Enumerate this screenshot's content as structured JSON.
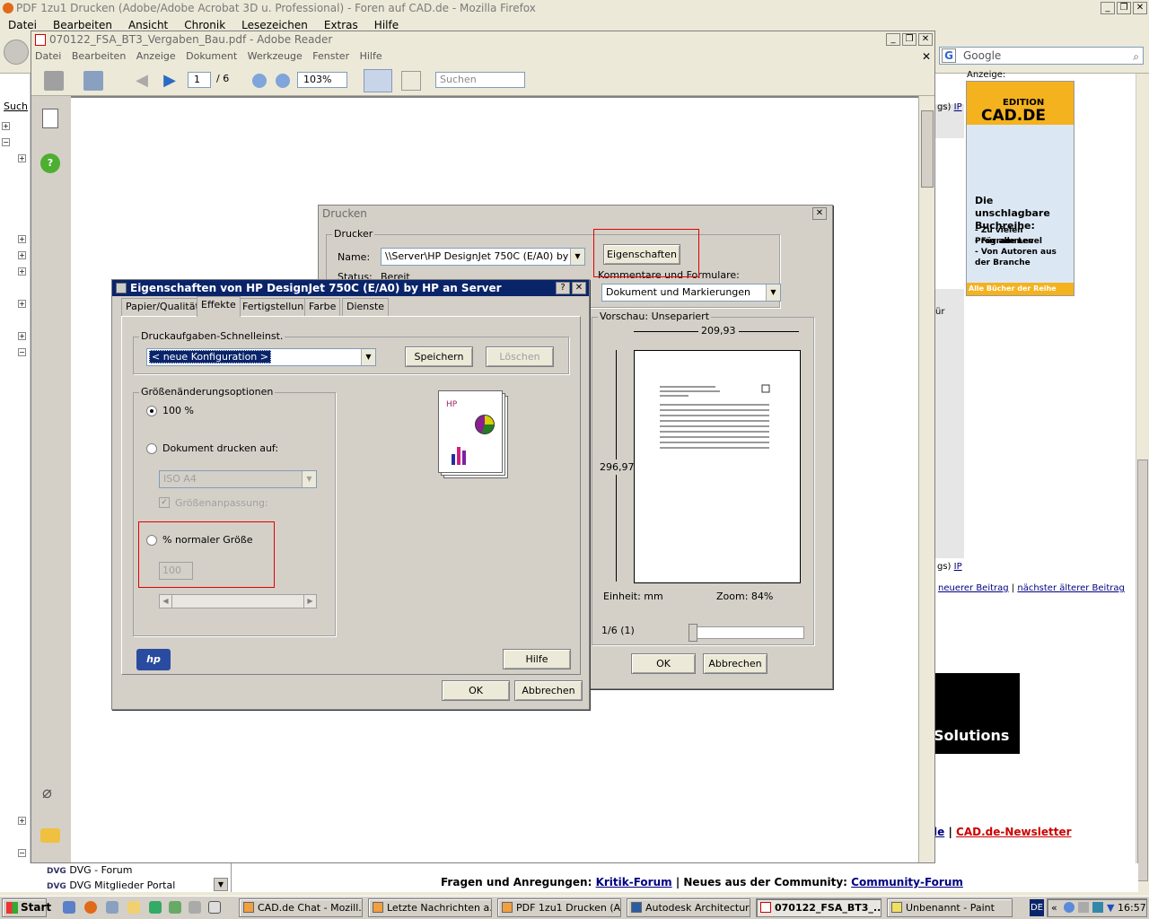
{
  "firefox": {
    "title": "PDF 1zu1 Drucken (Adobe/Adobe Acrobat 3D u. Professional) - Foren auf CAD.de - Mozilla Firefox",
    "menu": [
      "Datei",
      "Bearbeiten",
      "Ansicht",
      "Chronik",
      "Lesezeichen",
      "Extras",
      "Hilfe"
    ],
    "search_placeholder": "Google",
    "ad_label": "Anzeige:",
    "ad": {
      "edition": "EDITION",
      "brand": "CAD.DE",
      "headline": "Die unschlagbare Buchreihe:",
      "bullets": [
        "- Zu vielen Programmen",
        "- Für alle Level",
        "- Von Autoren aus der Branche"
      ],
      "footer": "Alle Bücher der Reihe hier >>"
    },
    "page_links": {
      "ip": "IP",
      "newer": "neuerer Beitrag",
      "older": "nächster älterer Beitrag",
      "newsletter": "CAD.de-Newsletter",
      "solutions": "Solutions",
      "ur": "ür"
    },
    "footer": {
      "prefix": "Fragen und Anregungen:",
      "kritik": "Kritik-Forum",
      "middle": "| Neues aus der Community:",
      "community": "Community-Forum"
    },
    "sidebar": {
      "search": "Such",
      "items": [
        "DVG - Forum",
        "DVG Mitglieder Portal"
      ]
    }
  },
  "reader": {
    "title": "070122_FSA_BT3_Vergaben_Bau.pdf - Adobe Reader",
    "menu": [
      "Datei",
      "Bearbeiten",
      "Anzeige",
      "Dokument",
      "Werkzeuge",
      "Fenster",
      "Hilfe"
    ],
    "page_current": "1",
    "page_total": "/ 6",
    "zoom": "103%",
    "search_placeholder": "Suchen"
  },
  "print_dialog": {
    "title": "Drucken",
    "printer_group": "Drucker",
    "name_label": "Name:",
    "printer_name": "\\\\Server\\HP DesignJet 750C (E/A0) by HP",
    "status_label": "Status:",
    "status_value": "Bereit",
    "properties_button": "Eigenschaften",
    "comments_label": "Kommentare und Formulare:",
    "comments_value": "Dokument und Markierungen",
    "preview_label": "Vorschau: Unsepariert",
    "width_value": "209,93",
    "height_value": "296,97",
    "unit": "Einheit: mm",
    "zoom": "Zoom:  84%",
    "page_indicator": "1/6 (1)",
    "ok": "OK",
    "cancel": "Abbrechen"
  },
  "props_dialog": {
    "title": "Eigenschaften von HP DesignJet 750C (E/A0) by HP an Server",
    "tabs": [
      "Papier/Qualität",
      "Effekte",
      "Fertigstellung",
      "Farbe",
      "Dienste"
    ],
    "quickset_group": "Druckaufgaben-Schnelleinst.",
    "quickset_value": "< neue Konfiguration >",
    "save": "Speichern",
    "delete": "Löschen",
    "resize_group": "Größenänderungsoptionen",
    "opt_100": "100 %",
    "opt_print_on": "Dokument drucken auf:",
    "paper": "ISO A4",
    "fit": "Größenanpassung:",
    "opt_percent": "% normaler Größe",
    "percent_value": "100",
    "preview_hp": "HP",
    "help": "Hilfe",
    "hp_logo": "hp",
    "ok": "OK",
    "cancel": "Abbrechen"
  },
  "taskbar": {
    "start": "Start",
    "tasks": [
      "CAD.de Chat - Mozill...",
      "Letzte Nachrichten a...",
      "PDF 1zu1 Drucken (A...",
      "Autodesk Architectur...",
      "070122_FSA_BT3_...",
      "Unbenannt - Paint"
    ],
    "lang": "DE",
    "time": "16:57"
  },
  "colors": {
    "title_active": "#0a246a",
    "red_box": "#e00000",
    "ad_orange": "#f4b21f"
  }
}
